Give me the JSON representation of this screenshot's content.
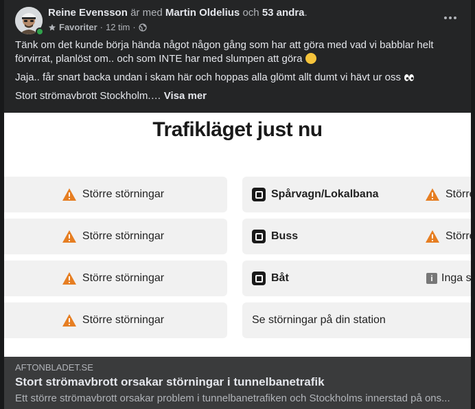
{
  "post": {
    "author": "Reine Evensson",
    "with_text": "är med",
    "tagged": "Martin Oldelius",
    "and_text": "och",
    "others": "53 andra",
    "period": ".",
    "favorites_label": "Favoriter",
    "time": "12 tim",
    "separator": "·",
    "more_icon": "more-horizontal-icon",
    "paragraph1": "Tänk om det kunde börja hända något någon gång som har att göra med vad vi babblar helt förvirrat, planlöst om.. och som INTE har med slumpen att göra",
    "paragraph2": "Jaja.. får snart backa undan i skam här och hoppas alla glömt allt dumt vi hävt ur oss",
    "paragraph3": "Stort strömavbrott Stockholm.…",
    "see_more": "Visa mer"
  },
  "link_image": {
    "title": "Trafikläget just nu",
    "left_tiles": [
      "Större störningar",
      "Större störningar",
      "Större störningar",
      "Större störningar"
    ],
    "right_tiles": [
      {
        "label": "Spårvagn/Lokalbana",
        "status": "Större"
      },
      {
        "label": "Buss",
        "status": "Större"
      },
      {
        "label": "Båt",
        "status": "Inga s"
      },
      {
        "label": "Se störningar på din station",
        "status": ""
      }
    ],
    "warning_color": "#e67e22"
  },
  "link": {
    "domain": "AFTONBLADET.SE",
    "title": "Stort strömavbrott orsakar störningar i tunnelbanetrafik",
    "description": "Ett större strömavbrott orsakar problem i tunnelbanetrafiken och Stockholms innerstad på ons..."
  }
}
